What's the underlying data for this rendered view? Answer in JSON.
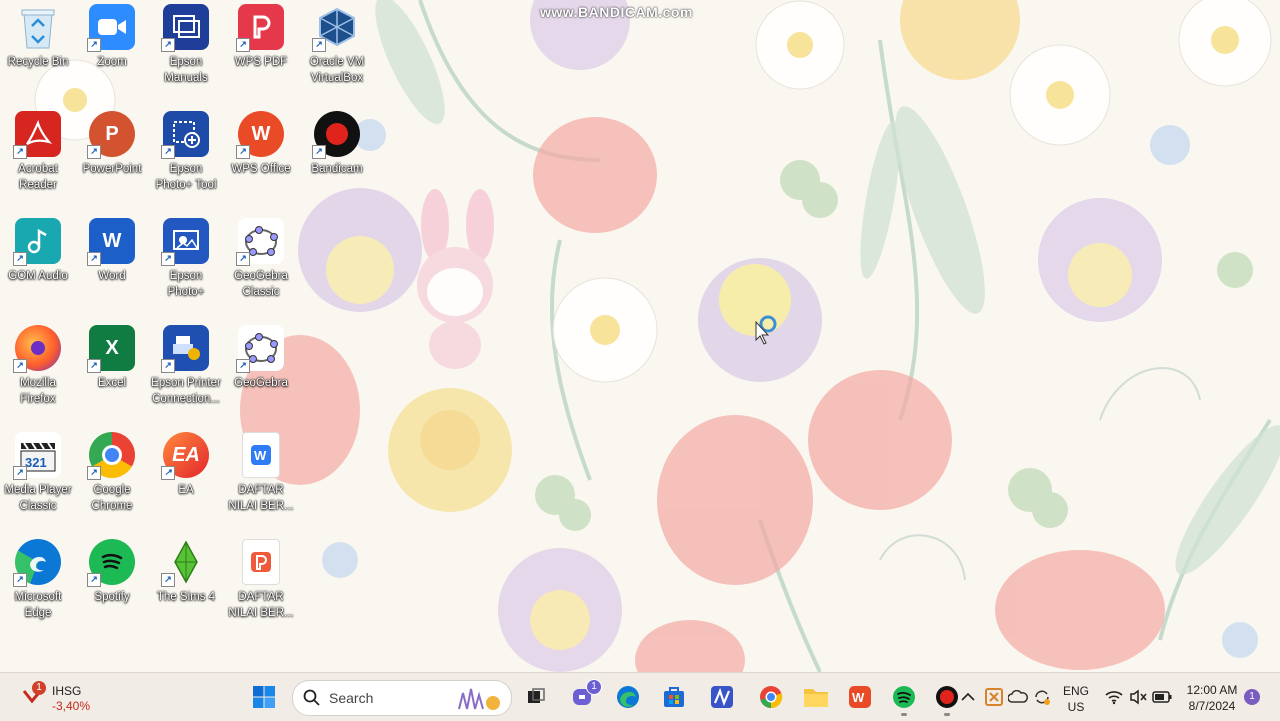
{
  "watermark": "www.BANDICAM.com",
  "desktop_icons": [
    {
      "label": "Recycle Bin",
      "icon": "recycle-bin-icon"
    },
    {
      "label": "Zoom",
      "icon": "zoom-icon"
    },
    {
      "label": "Epson\nManuals",
      "icon": "epson-manuals-icon"
    },
    {
      "label": "WPS PDF",
      "icon": "wps-pdf-icon"
    },
    {
      "label": "Oracle VM\nVirtualBox",
      "icon": "virtualbox-icon"
    },
    {
      "label": "Acrobat\nReader",
      "icon": "acrobat-icon"
    },
    {
      "label": "PowerPoint",
      "icon": "powerpoint-icon"
    },
    {
      "label": "Epson\nPhoto+ Tool",
      "icon": "epson-photo-tool-icon"
    },
    {
      "label": "WPS Office",
      "icon": "wps-office-icon"
    },
    {
      "label": "Bandicam",
      "icon": "bandicam-icon"
    },
    {
      "label": "GOM Audio",
      "icon": "gom-audio-icon"
    },
    {
      "label": "Word",
      "icon": "word-icon"
    },
    {
      "label": "Epson\nPhoto+",
      "icon": "epson-photo-icon"
    },
    {
      "label": "GeoGebra\nClassic",
      "icon": "geogebra-classic-icon"
    },
    {
      "label": "Mozilla\nFirefox",
      "icon": "firefox-icon"
    },
    {
      "label": "Excel",
      "icon": "excel-icon"
    },
    {
      "label": "Epson Printer\nConnection...",
      "icon": "epson-printer-icon"
    },
    {
      "label": "GeoGebra",
      "icon": "geogebra-icon"
    },
    {
      "label": "Media Player\nClassic",
      "icon": "media-player-icon"
    },
    {
      "label": "Google\nChrome",
      "icon": "chrome-icon"
    },
    {
      "label": "EA",
      "icon": "ea-icon"
    },
    {
      "label": "DAFTAR\nNILAI BER...",
      "icon": "wps-doc-icon"
    },
    {
      "label": "Microsoft\nEdge",
      "icon": "edge-icon"
    },
    {
      "label": "Spotify",
      "icon": "spotify-icon"
    },
    {
      "label": "The Sims 4",
      "icon": "sims-icon"
    },
    {
      "label": "DAFTAR\nNILAI BER...",
      "icon": "wps-pdf-file-icon"
    }
  ],
  "taskbar": {
    "stock": {
      "name": "IHSG",
      "change": "-3,40%",
      "badge": "1"
    },
    "search_label": "Search",
    "chat_badge": "1",
    "language": "ENG",
    "region": "US",
    "time": "12:00 AM",
    "date": "8/7/2024",
    "notification_count": "1"
  },
  "colors": {
    "taskbar_bg": "#f1ece5",
    "accent": "#0067c0",
    "stock_negative": "#c42b1c"
  }
}
